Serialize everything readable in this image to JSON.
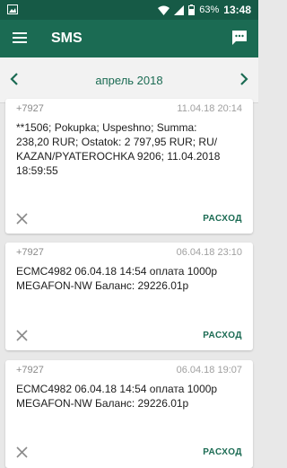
{
  "status": {
    "battery": "63%",
    "time": "13:48"
  },
  "app": {
    "title": "SMS"
  },
  "month": {
    "label": "апрель 2018"
  },
  "messages": [
    {
      "sender": "+7927",
      "date": "11.04.18 20:14",
      "text": "**1506; Pokupka; Uspeshno; Summa:\n238,20 RUR; Ostatok: 2 797,95 RUR; RU/\nKAZAN/PYATEROCHKA 9206; 11.04.2018\n18:59:55",
      "action": "РАСХОД"
    },
    {
      "sender": "+7927",
      "date": "06.04.18 23:10",
      "text": "ECMC4982 06.04.18 14:54 оплата 1000р\nMEGAFON-NW Баланс: 29226.01р",
      "action": "РАСХОД"
    },
    {
      "sender": "+7927",
      "date": "06.04.18 19:07",
      "text": "ECMC4982 06.04.18 14:54 оплата 1000р\nMEGAFON-NW Баланс: 29226.01р",
      "action": "РАСХОД"
    }
  ]
}
